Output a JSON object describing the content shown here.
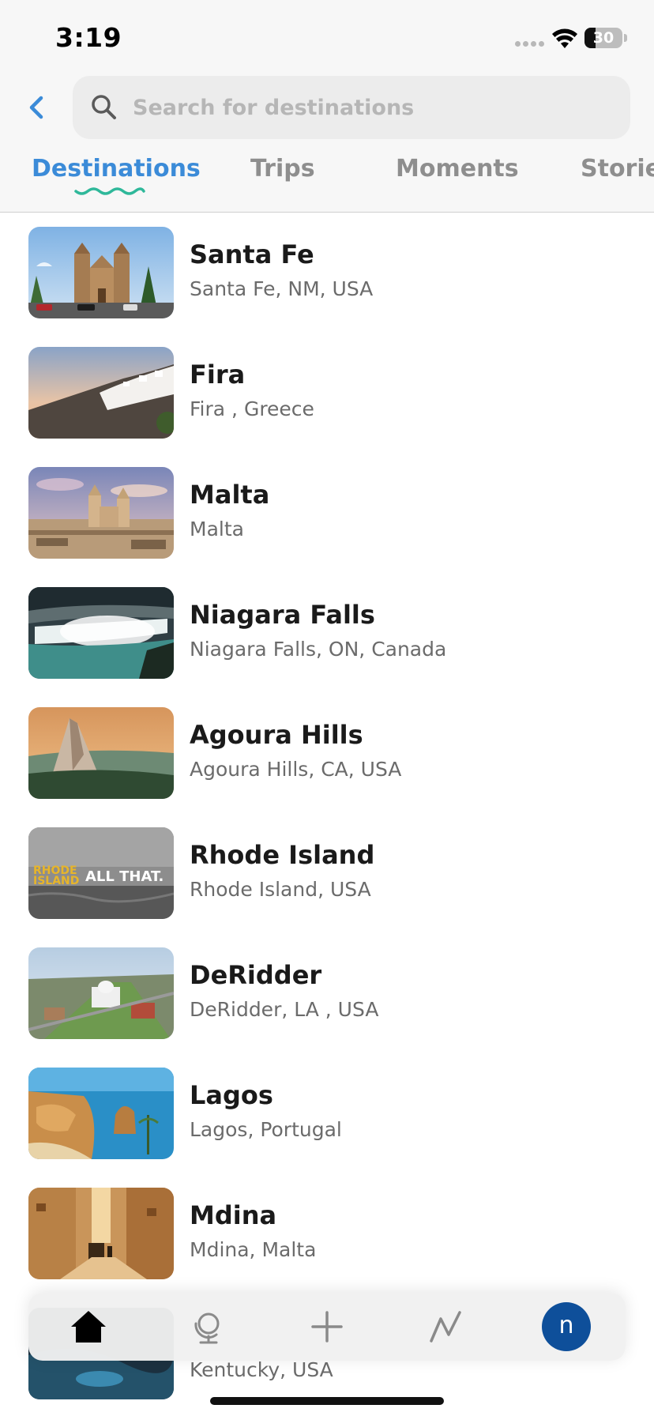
{
  "status_bar": {
    "time": "3:19",
    "battery_level": "30"
  },
  "search": {
    "placeholder": "Search for destinations",
    "value": ""
  },
  "tabs": [
    {
      "label": "Destinations",
      "active": true
    },
    {
      "label": "Trips",
      "active": false
    },
    {
      "label": "Moments",
      "active": false
    },
    {
      "label": "Stories",
      "active": false
    }
  ],
  "accent_color": "#3b8bd8",
  "underline_color": "#2fb89a",
  "destinations": [
    {
      "name": "Santa Fe",
      "location": "Santa Fe, NM, USA"
    },
    {
      "name": "Fira",
      "location": "Fira , Greece"
    },
    {
      "name": "Malta",
      "location": "Malta"
    },
    {
      "name": "Niagara Falls",
      "location": "Niagara Falls, ON, Canada"
    },
    {
      "name": "Agoura Hills",
      "location": "Agoura Hills, CA, USA"
    },
    {
      "name": "Rhode Island",
      "location": "Rhode Island, USA",
      "thumb_text": [
        "RHODE",
        "ISLAND",
        "ALL THAT."
      ]
    },
    {
      "name": "DeRidder",
      "location": "DeRidder, LA , USA"
    },
    {
      "name": "Lagos",
      "location": "Lagos, Portugal"
    },
    {
      "name": "Mdina",
      "location": "Mdina, Malta"
    },
    {
      "name": "",
      "location": "Kentucky, USA"
    }
  ],
  "tabbar": {
    "items": [
      {
        "icon": "home-icon"
      },
      {
        "icon": "globe-icon"
      },
      {
        "icon": "plus-icon"
      },
      {
        "icon": "activity-icon"
      }
    ],
    "avatar_initial": "n",
    "avatar_color": "#0e4f9a"
  }
}
